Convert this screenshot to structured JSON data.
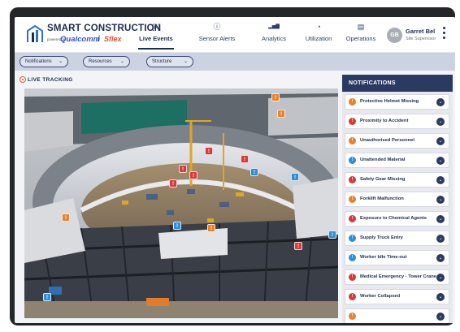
{
  "app": {
    "brand": "SMART CONSTRUCTION",
    "powered_by": "powered by",
    "partner1": "Qualcomm",
    "separator": "/",
    "partner2": "Sflex"
  },
  "nav": [
    {
      "label": "Live Events",
      "icon": "play-icon",
      "glyph": "[▸]",
      "active": true
    },
    {
      "label": "Sensor Alerts",
      "icon": "alert-circle-icon",
      "glyph": "ⓘ",
      "active": false
    },
    {
      "label": "Analytics",
      "icon": "bar-chart-icon",
      "glyph": "▂▅▇",
      "active": false
    },
    {
      "label": "Utilization",
      "icon": "gauge-icon",
      "glyph": "◔",
      "active": false
    },
    {
      "label": "Operations",
      "icon": "clipboard-icon",
      "glyph": "▤",
      "active": false
    }
  ],
  "user": {
    "initials": "GB",
    "name": "Garret Bel",
    "role": "Site Supervisor"
  },
  "filters": [
    {
      "label": "Notifications"
    },
    {
      "label": "Resources"
    },
    {
      "label": "Structure"
    }
  ],
  "live_tracking": {
    "title": "LIVE TRACKING"
  },
  "notifications": {
    "title": "NOTIFICATIONS",
    "items": [
      {
        "label": "Protective Helmet Missing",
        "color": "#e8822f",
        "icon": "helmet-icon"
      },
      {
        "label": "Proximity to Accident",
        "color": "#d63a3a",
        "icon": "accident-icon"
      },
      {
        "label": "Unauthorised Personnel",
        "color": "#e8822f",
        "icon": "person-warning-icon"
      },
      {
        "label": "Unattended Material",
        "color": "#2f8fd6",
        "icon": "material-icon"
      },
      {
        "label": "Safety Gear Missing",
        "color": "#d63a3a",
        "icon": "vest-icon"
      },
      {
        "label": "Forklift Malfunction",
        "color": "#e8822f",
        "icon": "forklift-icon"
      },
      {
        "label": "Exposure to Chemical Agents",
        "color": "#d63a3a",
        "icon": "chemical-icon"
      },
      {
        "label": "Supply Truck Entry",
        "color": "#2f8fd6",
        "icon": "truck-icon"
      },
      {
        "label": "Worker Idle Time-out",
        "color": "#2f8fd6",
        "icon": "clock-icon"
      },
      {
        "label": "Medical Emergency - Tower Crane",
        "color": "#d63a3a",
        "icon": "medical-icon"
      },
      {
        "label": "Worker Collapsed",
        "color": "#d63a3a",
        "icon": "collapsed-icon"
      },
      {
        "label": "",
        "color": "#e8822f",
        "icon": "warning-icon"
      }
    ]
  },
  "markers": [
    {
      "type": "warning",
      "color": "#e8822f"
    },
    {
      "type": "warning",
      "color": "#e8822f"
    },
    {
      "type": "alert",
      "color": "#d63a3a"
    },
    {
      "type": "alert",
      "color": "#d63a3a"
    },
    {
      "type": "alert",
      "color": "#d63a3a"
    },
    {
      "type": "alert",
      "color": "#d63a3a"
    },
    {
      "type": "alert",
      "color": "#d63a3a"
    },
    {
      "type": "info",
      "color": "#2f8fd6"
    },
    {
      "type": "info",
      "color": "#2f8fd6"
    },
    {
      "type": "info",
      "color": "#2f8fd6"
    },
    {
      "type": "warning",
      "color": "#e8822f"
    },
    {
      "type": "info",
      "color": "#2f8fd6"
    },
    {
      "type": "alert",
      "color": "#d63a3a"
    },
    {
      "type": "info",
      "color": "#2f8fd6"
    },
    {
      "type": "warning",
      "color": "#e8822f"
    }
  ]
}
